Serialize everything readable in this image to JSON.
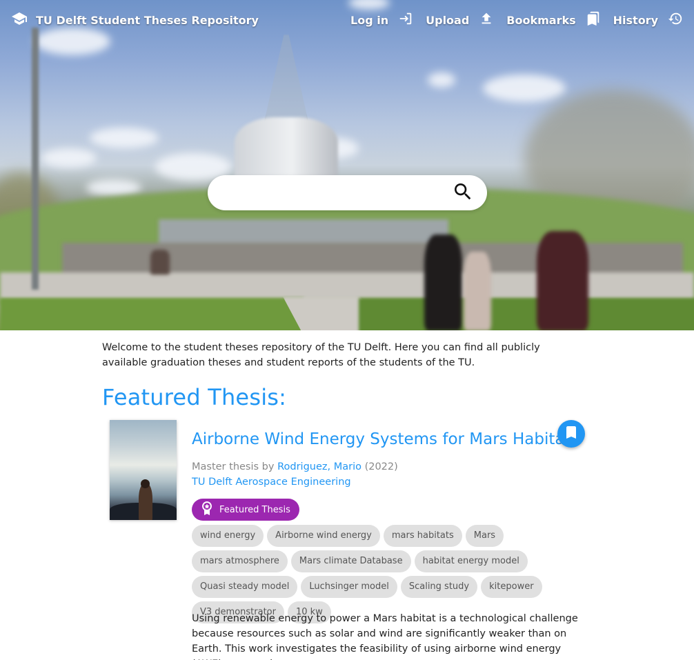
{
  "header": {
    "brand_title": "TU Delft Student Theses Repository",
    "brand_icon": "graduation-cap-icon",
    "nav": [
      {
        "label": "Log in",
        "icon": "login-icon"
      },
      {
        "label": "Upload",
        "icon": "upload-icon"
      },
      {
        "label": "Bookmarks",
        "icon": "bookmarks-icon"
      },
      {
        "label": "History",
        "icon": "history-icon"
      }
    ]
  },
  "search": {
    "placeholder": "",
    "icon": "search-icon"
  },
  "intro_text": "Welcome to the student theses repository of the TU Delft. Here you can find all publicly available graduation theses and student reports of the students of the TU.",
  "featured": {
    "section_title": "Featured Thesis:",
    "title": "Airborne Wind Energy Systems for Mars Habitats",
    "type_prefix": "Master thesis by",
    "author": "Rodriguez, Mario",
    "year": "(2022)",
    "faculty": "TU Delft Aerospace Engineering",
    "badge": "Featured Thesis",
    "keywords": [
      "wind energy",
      "Airborne wind energy",
      "mars habitats",
      "Mars",
      "mars atmosphere",
      "Mars climate Database",
      "habitat energy model",
      "Quasi steady model",
      "Luchsinger model",
      "Scaling study",
      "kitepower",
      "V3 demonstrator",
      "10 kw"
    ],
    "abstract": "Using renewable energy to power a Mars habitat is a technological challenge because resources such as solar and wind are significantly weaker than on Earth. This work investigates the feasibility of using airborne wind energy (AWE) systems in"
  },
  "colors": {
    "accent": "#2196f3",
    "badge": "#9c27b0",
    "chip_bg": "#e0e0e0"
  }
}
